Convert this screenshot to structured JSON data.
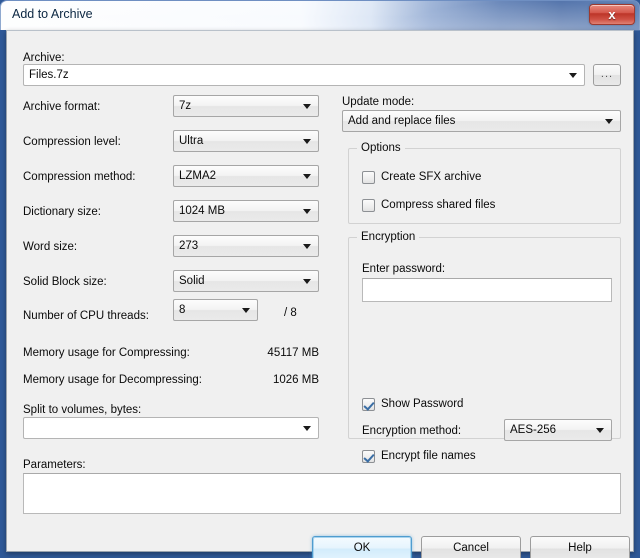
{
  "window": {
    "title": "Add to Archive",
    "close_icon": "close-icon",
    "close_label": "x"
  },
  "archive": {
    "label": "Archive:",
    "value": "Files.7z",
    "placeholder": "",
    "browse_label": "..."
  },
  "left_column": {
    "archive_format": {
      "label": "Archive format:",
      "value": "7z"
    },
    "compression_level": {
      "label": "Compression level:",
      "value": "Ultra"
    },
    "compression_method": {
      "label": "Compression method:",
      "value": "LZMA2"
    },
    "dictionary_size": {
      "label": "Dictionary size:",
      "value": "1024 MB"
    },
    "word_size": {
      "label": "Word size:",
      "value": "273"
    },
    "solid_block_size": {
      "label": "Solid Block size:",
      "value": "Solid"
    },
    "cpu_threads": {
      "label": "Number of CPU threads:",
      "value": "8",
      "max_suffix": "/ 8"
    },
    "memory_compressing": {
      "label": "Memory usage for Compressing:",
      "value": "45117 MB"
    },
    "memory_decompressing": {
      "label": "Memory usage for Decompressing:",
      "value": "1026 MB"
    },
    "split_volumes": {
      "label": "Split to volumes, bytes:",
      "value": ""
    }
  },
  "right_column": {
    "update_mode": {
      "label": "Update mode:",
      "value": "Add and replace files"
    },
    "options": {
      "title": "Options",
      "create_sfx": {
        "label": "Create SFX archive",
        "checked": false
      },
      "compress_shared": {
        "label": "Compress shared files",
        "checked": false
      }
    },
    "encryption": {
      "title": "Encryption",
      "password_label": "Enter password:",
      "password_value": "",
      "show_password": {
        "label": "Show Password",
        "checked": true
      },
      "method_label": "Encryption method:",
      "method_value": "AES-256",
      "encrypt_file_names": {
        "label": "Encrypt file names",
        "checked": true
      }
    }
  },
  "parameters": {
    "label": "Parameters:",
    "value": ""
  },
  "buttons": {
    "ok": "OK",
    "cancel": "Cancel",
    "help": "Help"
  },
  "colors": {
    "dialog_bg": "#f0f0f0",
    "close_red": "#c0392b",
    "default_button_blue": "#4f9ccf",
    "checkmark_blue": "#3a6ea5"
  }
}
